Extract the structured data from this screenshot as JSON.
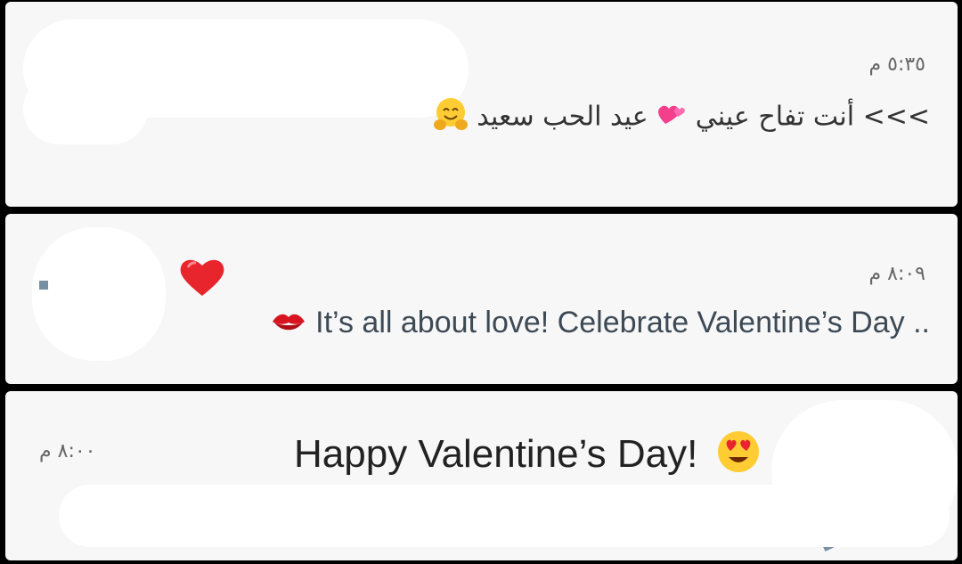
{
  "notifications": [
    {
      "time": "٥:٣٥ م",
      "text_prefix": ">>> أنت تفاح عيني",
      "text_suffix": "عيد الحب سعيد",
      "emojis": [
        "two-hearts-icon",
        "hugging-face-icon"
      ]
    },
    {
      "time": "٨:٠٩ م",
      "text": "It’s all about love! Celebrate Valentine’s Day ..",
      "emojis": [
        "red-heart-icon",
        "kiss-mark-icon"
      ]
    },
    {
      "time": "٨:٠٠ م",
      "text": "Happy Valentine’s Day!",
      "emojis": [
        "heart-eyes-face-icon"
      ]
    }
  ],
  "colors": {
    "background": "#000000",
    "card": "#f7f7f8",
    "avatar_orange": "#ee5a2c",
    "avatar_slate": "#7890a3",
    "heart_red": "#e8242d"
  }
}
